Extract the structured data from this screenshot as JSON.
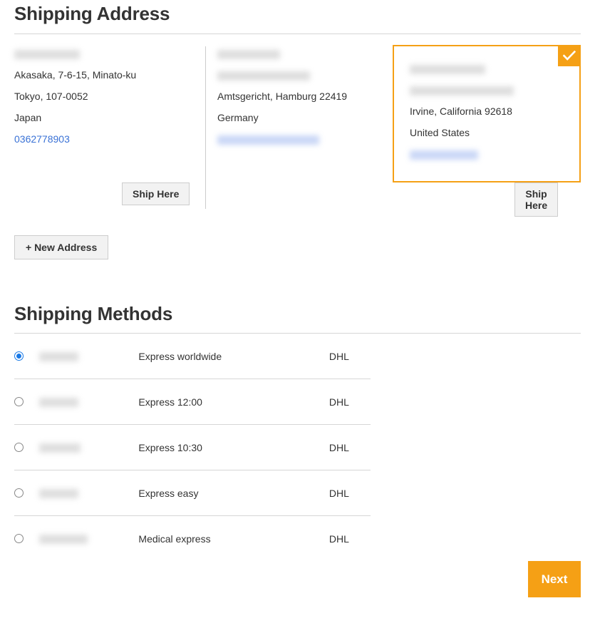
{
  "sections": {
    "address": {
      "title": "Shipping Address"
    },
    "methods": {
      "title": "Shipping Methods"
    }
  },
  "colors": {
    "accent": "#f5a015",
    "link": "#3a72d6",
    "radio_selected": "#1979e6",
    "rule": "#d6d6d6",
    "button_face": "#f2f2f2",
    "text": "#333333"
  },
  "addresses": [
    {
      "name_redacted": true,
      "name_width": 92,
      "lines": [
        "Akasaka, 7-6-15, Minato-ku",
        "Tokyo, 107-0052",
        "Japan"
      ],
      "phone": "0362778903",
      "phone_redacted": false,
      "ship_here_label": "Ship Here",
      "selected": false
    },
    {
      "name_redacted": true,
      "name_width": 88,
      "street_redacted": true,
      "street_width": 130,
      "lines": [
        "Amtsgericht, Hamburg 22419",
        "Germany"
      ],
      "phone": "",
      "phone_redacted": true,
      "phone_width": 143,
      "ship_here_label": "Ship Here",
      "selected": false
    },
    {
      "name_redacted": true,
      "name_width": 106,
      "street_redacted": true,
      "street_width": 146,
      "lines": [
        "Irvine, California 92618",
        "United States"
      ],
      "phone": "",
      "phone_redacted": true,
      "phone_width": 96,
      "selected": true,
      "selected_badge_icon": "check-icon"
    }
  ],
  "new_address_button": {
    "label": "+ New Address"
  },
  "shipping_methods": {
    "columns": [
      "select",
      "price",
      "method",
      "carrier"
    ],
    "rows": [
      {
        "price_redacted": true,
        "price_width": 55,
        "method": "Express worldwide",
        "carrier": "DHL",
        "selected": true
      },
      {
        "price_redacted": true,
        "price_width": 55,
        "method": "Express 12:00",
        "carrier": "DHL",
        "selected": false
      },
      {
        "price_redacted": true,
        "price_width": 58,
        "method": "Express 10:30",
        "carrier": "DHL",
        "selected": false
      },
      {
        "price_redacted": true,
        "price_width": 55,
        "method": "Express easy",
        "carrier": "DHL",
        "selected": false
      },
      {
        "price_redacted": true,
        "price_width": 68,
        "method": "Medical express",
        "carrier": "DHL",
        "selected": false
      }
    ]
  },
  "footer": {
    "next_label": "Next"
  }
}
